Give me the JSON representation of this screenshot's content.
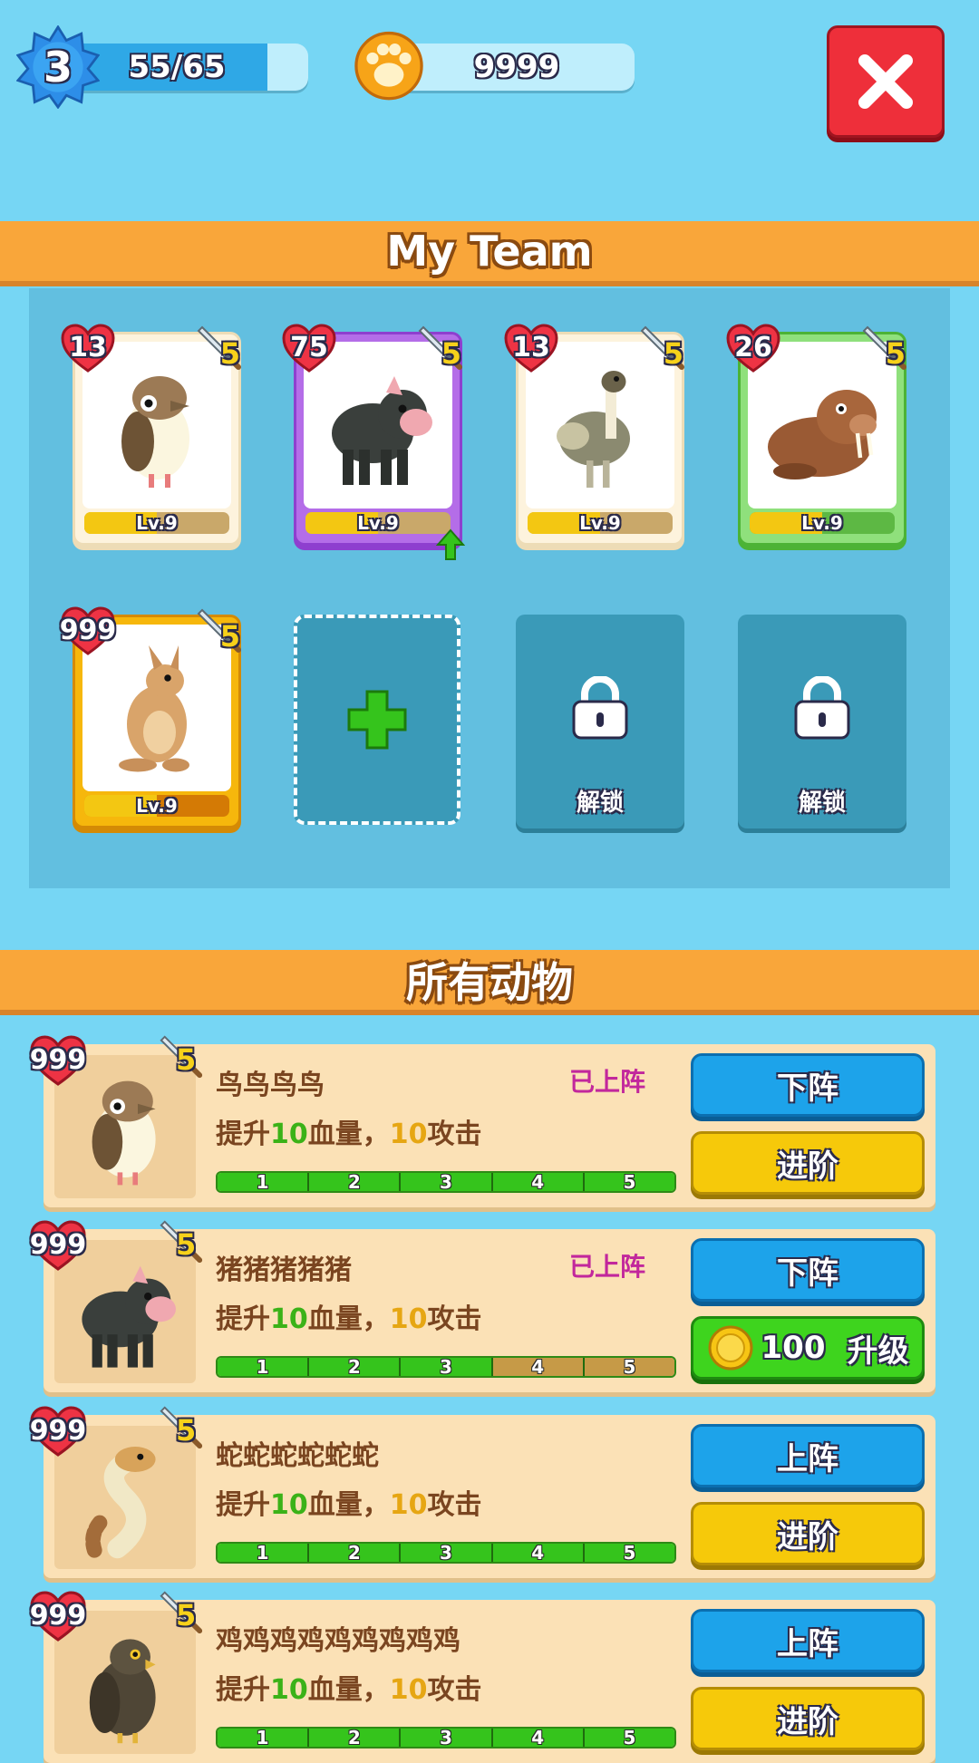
{
  "hud": {
    "level": "3",
    "xp_text": "55/65",
    "xp_fraction": 0.846,
    "paws": "9999"
  },
  "sections": {
    "team_title": "My Team",
    "all_title": "所有动物"
  },
  "team": [
    {
      "hp": "13",
      "atk": "5",
      "level": "Lv.9",
      "rarity": "white",
      "animal": "bird-icon",
      "frame_color": "#fdf3dd",
      "upgrade_available": false
    },
    {
      "hp": "75",
      "atk": "5",
      "level": "Lv.9",
      "rarity": "purple",
      "animal": "pig-icon",
      "frame_color": "#b46de8",
      "upgrade_available": true
    },
    {
      "hp": "13",
      "atk": "5",
      "level": "Lv.9",
      "rarity": "white",
      "animal": "emu-icon",
      "frame_color": "#fdf3dd",
      "upgrade_available": false
    },
    {
      "hp": "26",
      "atk": "5",
      "level": "Lv.9",
      "rarity": "green",
      "animal": "walrus-icon",
      "frame_color": "#8fe07c",
      "upgrade_available": false
    },
    {
      "hp": "999",
      "atk": "5",
      "level": "Lv.9",
      "rarity": "gold",
      "animal": "kangaroo-icon",
      "frame_color": "#f6b70c",
      "upgrade_available": false
    }
  ],
  "locked_label": "解锁",
  "animals": [
    {
      "name": "鸟鸟鸟鸟",
      "status": "已上阵",
      "desc_prefix": "提升",
      "hp_boost": "10",
      "desc_mid": "血量，",
      "atk_boost": "10",
      "desc_suffix": "攻击",
      "hp": "999",
      "atk": "5",
      "progress_steps": [
        "1",
        "2",
        "3",
        "4",
        "5"
      ],
      "progress_filled": 5,
      "primary_button": "下阵",
      "secondary_button": "进阶",
      "secondary_type": "advance",
      "animal": "bird-icon"
    },
    {
      "name": "猪猪猪猪猪",
      "status": "已上阵",
      "desc_prefix": "提升",
      "hp_boost": "10",
      "desc_mid": "血量，",
      "atk_boost": "10",
      "desc_suffix": "攻击",
      "hp": "999",
      "atk": "5",
      "progress_steps": [
        "1",
        "2",
        "3",
        "4",
        "5"
      ],
      "progress_filled": 3,
      "primary_button": "下阵",
      "secondary_button": "升级",
      "secondary_cost": "100",
      "secondary_type": "upgrade",
      "animal": "pig-icon"
    },
    {
      "name": "蛇蛇蛇蛇蛇蛇",
      "status": "",
      "desc_prefix": "提升",
      "hp_boost": "10",
      "desc_mid": "血量，",
      "atk_boost": "10",
      "desc_suffix": "攻击",
      "hp": "999",
      "atk": "5",
      "progress_steps": [
        "1",
        "2",
        "3",
        "4",
        "5"
      ],
      "progress_filled": 5,
      "primary_button": "上阵",
      "secondary_button": "进阶",
      "secondary_type": "advance",
      "animal": "snake-icon"
    },
    {
      "name": "鸡鸡鸡鸡鸡鸡鸡鸡鸡",
      "status": "",
      "desc_prefix": "提升",
      "hp_boost": "10",
      "desc_mid": "血量，",
      "atk_boost": "10",
      "desc_suffix": "攻击",
      "hp": "999",
      "atk": "5",
      "progress_steps": [
        "1",
        "2",
        "3",
        "4",
        "5"
      ],
      "progress_filled": 5,
      "primary_button": "上阵",
      "secondary_button": "进阶",
      "secondary_type": "advance",
      "animal": "hawk-icon"
    }
  ]
}
